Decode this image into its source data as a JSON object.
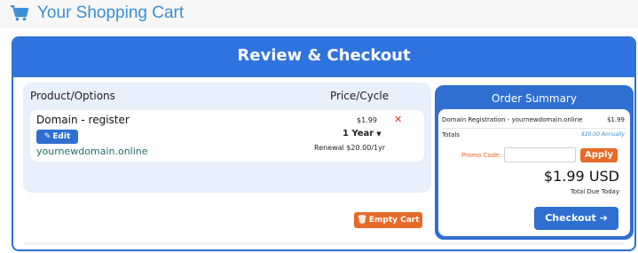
{
  "header": {
    "title": "Your Shopping Cart",
    "icon": "shopping-cart-icon"
  },
  "panel": {
    "title": "Review & Checkout"
  },
  "items_table": {
    "columns": [
      "Product/Options",
      "Price/Cycle"
    ],
    "items": [
      {
        "name": "Domain - register",
        "edit_label": "Edit",
        "domain": "yournewdomain.online",
        "price": "$1.99",
        "cycle": "1 Year",
        "renewal": "Renewal $20.00/1yr"
      }
    ],
    "empty_cart_label": "Empty Cart"
  },
  "order_summary": {
    "title": "Order Summary",
    "line_item": "Domain Registration - yournewdomain.online",
    "line_price": "$1.99",
    "totals_label": "Totals",
    "totals_value": "$20.00 Annually",
    "promo_label": "Promo Code:",
    "promo_value": "",
    "promo_placeholder": "",
    "apply_label": "Apply",
    "total_due": "$1.99 USD",
    "total_due_caption": "Total Due Today",
    "checkout_label": "Checkout"
  },
  "colors": {
    "primary": "#2f6fd1",
    "accent": "#e66a28",
    "title_blue": "#3a8ed4",
    "remove_red": "#d9331c"
  }
}
